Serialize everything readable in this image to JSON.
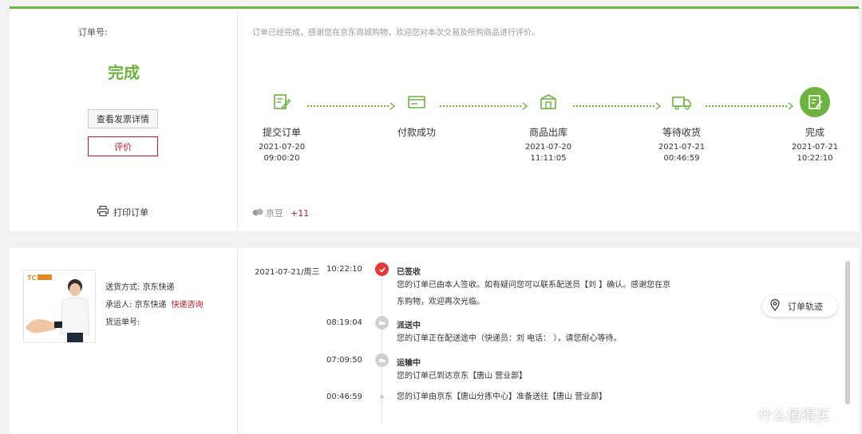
{
  "order": {
    "order_no_label": "订单号:",
    "status": "完成",
    "invoice_button": "查看发票详情",
    "review_button": "评价",
    "print_label": "打印订单",
    "thanks_message": "订单已经完成，感谢您在京东商城购物，欢迎您对本次交易及所购商品进行评价。",
    "jd_bean_label": "京豆",
    "jd_bean_value": "+11"
  },
  "steps": [
    {
      "label": "提交订单",
      "date": "2021-07-20",
      "time": "09:00:20",
      "icon": "submit-order-icon"
    },
    {
      "label": "付款成功",
      "date": "",
      "time": "",
      "icon": "payment-icon"
    },
    {
      "label": "商品出库",
      "date": "2021-07-20",
      "time": "11:11:05",
      "icon": "warehouse-out-icon"
    },
    {
      "label": "等待收货",
      "date": "2021-07-21",
      "time": "00:46:59",
      "icon": "truck-icon"
    },
    {
      "label": "完成",
      "date": "2021-07-21",
      "time": "10:22:10",
      "icon": "complete-icon"
    }
  ],
  "shipping": {
    "method_label": "送货方式:",
    "method_value": "京东快递",
    "carrier_label": "承运人:",
    "carrier_value": "京东快递",
    "carrier_link": "快递咨询",
    "tracking_label": "货运单号:"
  },
  "tracking": [
    {
      "date": "2021-07-21/周三",
      "time": "10:22:10",
      "title": "已签收",
      "lines": [
        "您的订单已由本人签收。如有疑问您可以联系配送员【刘                         】确认。感谢您在京",
        "东购物，欢迎再次光临。"
      ]
    },
    {
      "date": "",
      "time": "08:19:04",
      "title": "派送中",
      "lines": [
        "您的订单正在配送途中（快递员：刘          电话：                    ），请您耐心等待。"
      ]
    },
    {
      "date": "",
      "time": "07:09:50",
      "title": "运输中",
      "lines": [
        "您的订单已到达京东【唐山        营业部】"
      ]
    },
    {
      "date": "",
      "time": "00:46:59",
      "title": "",
      "lines": [
        "您的订单由京东【唐山分拣中心】准备送往【唐山        营业部】"
      ]
    }
  ],
  "track_button": "订单轨迹",
  "watermark": "什么值得买",
  "colors": {
    "green": "#6cb33f",
    "red": "#c81623",
    "dot_red": "#e4393c"
  }
}
